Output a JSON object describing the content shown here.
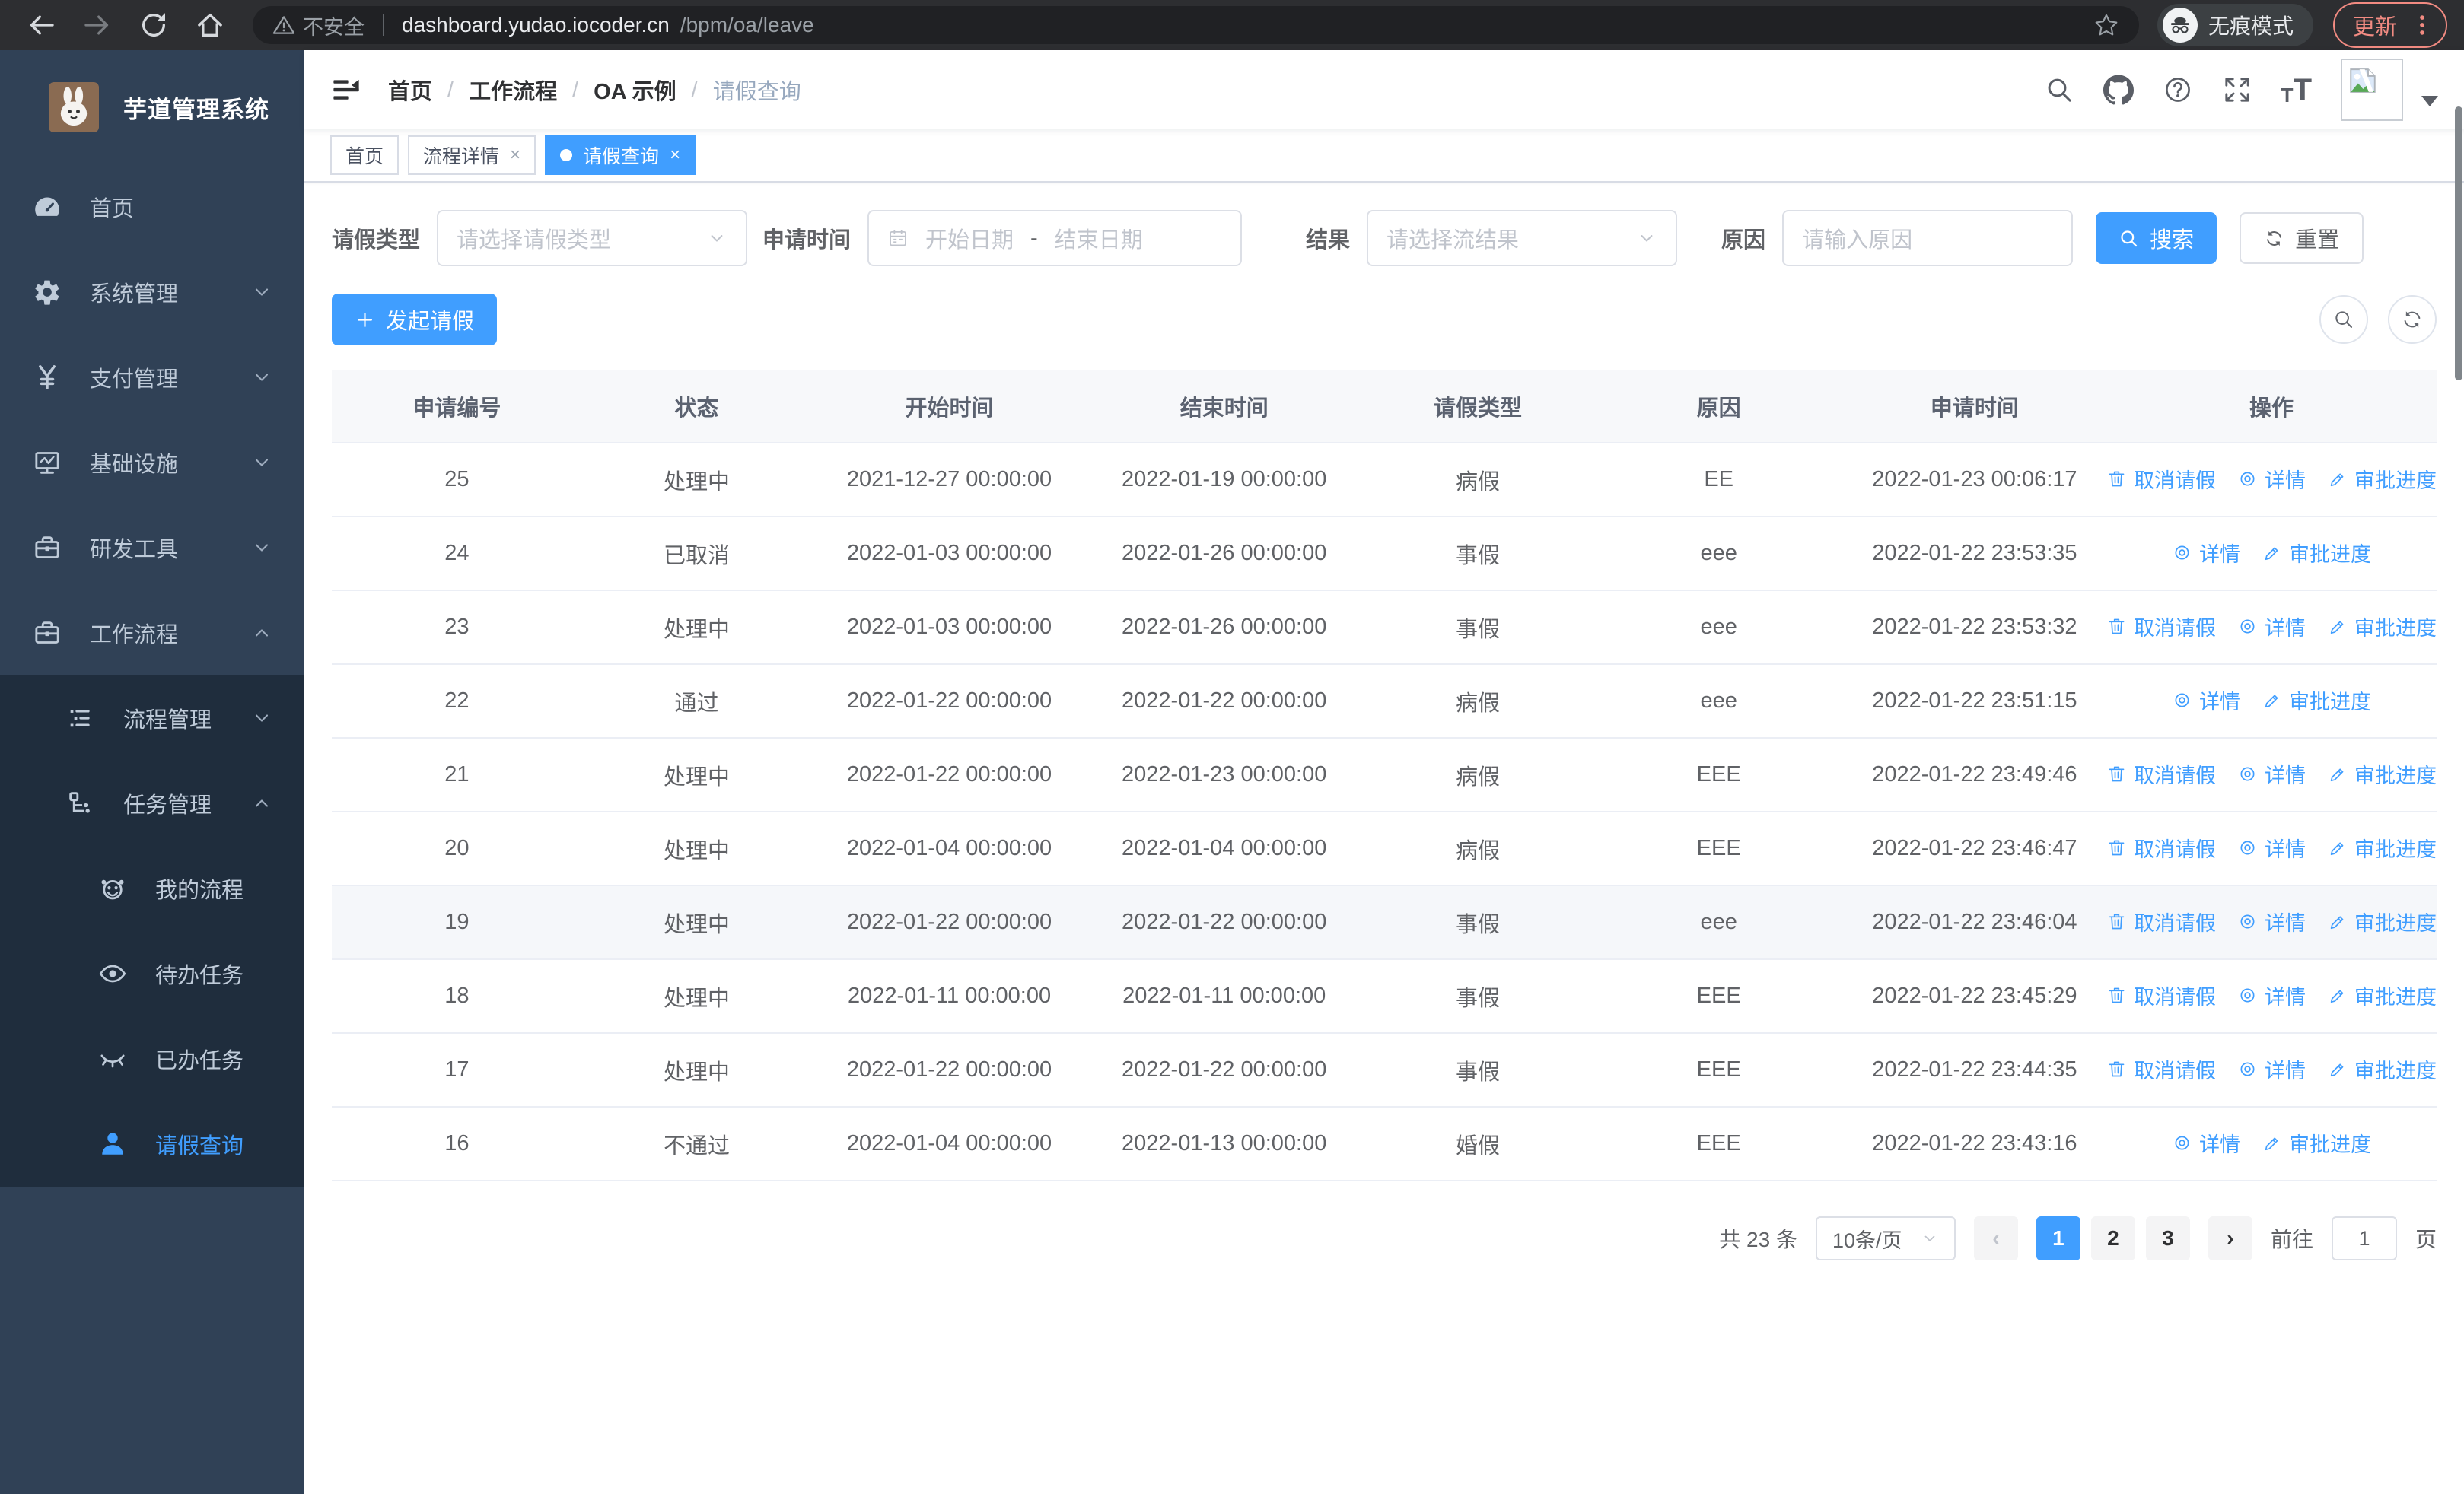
{
  "browser": {
    "security_label": "不安全",
    "url_host": "dashboard.yudao.iocoder.cn",
    "url_path": "/bpm/oa/leave",
    "incognito_label": "无痕模式",
    "update_label": "更新"
  },
  "colors": {
    "accent": "#409eff",
    "sidebar_bg": "#304156",
    "submenu_bg": "#1f2d3d",
    "update_accent": "#f28b82"
  },
  "sidebar": {
    "title": "芋道管理系统",
    "items": [
      {
        "name": "home",
        "label": "首页",
        "icon": "dashboard-icon",
        "level": 1
      },
      {
        "name": "system-management",
        "label": "系统管理",
        "icon": "gear-icon",
        "level": 1,
        "chevron": "down"
      },
      {
        "name": "payment-management",
        "label": "支付管理",
        "icon": "yen-icon",
        "level": 1,
        "chevron": "down"
      },
      {
        "name": "infrastructure",
        "label": "基础设施",
        "icon": "monitor-icon",
        "level": 1,
        "chevron": "down"
      },
      {
        "name": "dev-tools",
        "label": "研发工具",
        "icon": "toolbox-icon",
        "level": 1,
        "chevron": "down"
      },
      {
        "name": "workflow",
        "label": "工作流程",
        "icon": "briefcase-icon",
        "level": 1,
        "chevron": "up"
      },
      {
        "name": "process-management",
        "label": "流程管理",
        "icon": "list-icon",
        "level": 2,
        "chevron": "down",
        "in_submenu": true
      },
      {
        "name": "task-management",
        "label": "任务管理",
        "icon": "tree-icon",
        "level": 2,
        "chevron": "up",
        "in_submenu": true
      },
      {
        "name": "my-processes",
        "label": "我的流程",
        "icon": "robot-icon",
        "level": 3,
        "in_submenu": true
      },
      {
        "name": "todo-tasks",
        "label": "待办任务",
        "icon": "eye-icon",
        "level": 3,
        "in_submenu": true
      },
      {
        "name": "done-tasks",
        "label": "已办任务",
        "icon": "eye-closed-icon",
        "level": 3,
        "in_submenu": true
      },
      {
        "name": "leave-query",
        "label": "请假查询",
        "icon": "user-icon",
        "level": 3,
        "in_submenu": true,
        "active": true
      }
    ]
  },
  "navbar": {
    "breadcrumb": [
      "首页",
      "工作流程",
      "OA 示例",
      "请假查询"
    ]
  },
  "tabs": [
    {
      "name": "home",
      "label": "首页"
    },
    {
      "name": "process-detail",
      "label": "流程详情",
      "closable": true
    },
    {
      "name": "leave-query",
      "label": "请假查询",
      "closable": true,
      "active": true
    }
  ],
  "filters": {
    "leave_type": {
      "label": "请假类型",
      "placeholder": "请选择请假类型"
    },
    "apply_time": {
      "label": "申请时间",
      "start_placeholder": "开始日期",
      "separator": "-",
      "end_placeholder": "结束日期"
    },
    "result": {
      "label": "结果",
      "placeholder": "请选择流结果"
    },
    "reason": {
      "label": "原因",
      "placeholder": "请输入原因"
    },
    "search_label": "搜索",
    "reset_label": "重置"
  },
  "toolbar": {
    "create_label": "发起请假"
  },
  "table": {
    "columns": [
      "申请编号",
      "状态",
      "开始时间",
      "结束时间",
      "请假类型",
      "原因",
      "申请时间",
      "操作"
    ],
    "action_defs": {
      "cancel": {
        "label": "取消请假",
        "icon": "trash-icon"
      },
      "detail": {
        "label": "详情",
        "icon": "target-icon"
      },
      "progress": {
        "label": "审批进度",
        "icon": "edit-icon"
      }
    },
    "rows": [
      {
        "id": "25",
        "status": "处理中",
        "start": "2021-12-27 00:00:00",
        "end": "2022-01-19 00:00:00",
        "type": "病假",
        "reason": "EE",
        "apply": "2022-01-23 00:06:17",
        "actions": [
          "cancel",
          "detail",
          "progress"
        ]
      },
      {
        "id": "24",
        "status": "已取消",
        "start": "2022-01-03 00:00:00",
        "end": "2022-01-26 00:00:00",
        "type": "事假",
        "reason": "eee",
        "apply": "2022-01-22 23:53:35",
        "actions": [
          "detail",
          "progress"
        ]
      },
      {
        "id": "23",
        "status": "处理中",
        "start": "2022-01-03 00:00:00",
        "end": "2022-01-26 00:00:00",
        "type": "事假",
        "reason": "eee",
        "apply": "2022-01-22 23:53:32",
        "actions": [
          "cancel",
          "detail",
          "progress"
        ]
      },
      {
        "id": "22",
        "status": "通过",
        "start": "2022-01-22 00:00:00",
        "end": "2022-01-22 00:00:00",
        "type": "病假",
        "reason": "eee",
        "apply": "2022-01-22 23:51:15",
        "actions": [
          "detail",
          "progress"
        ]
      },
      {
        "id": "21",
        "status": "处理中",
        "start": "2022-01-22 00:00:00",
        "end": "2022-01-23 00:00:00",
        "type": "病假",
        "reason": "EEE",
        "apply": "2022-01-22 23:49:46",
        "actions": [
          "cancel",
          "detail",
          "progress"
        ]
      },
      {
        "id": "20",
        "status": "处理中",
        "start": "2022-01-04 00:00:00",
        "end": "2022-01-04 00:00:00",
        "type": "病假",
        "reason": "EEE",
        "apply": "2022-01-22 23:46:47",
        "actions": [
          "cancel",
          "detail",
          "progress"
        ]
      },
      {
        "id": "19",
        "status": "处理中",
        "start": "2022-01-22 00:00:00",
        "end": "2022-01-22 00:00:00",
        "type": "事假",
        "reason": "eee",
        "apply": "2022-01-22 23:46:04",
        "actions": [
          "cancel",
          "detail",
          "progress"
        ],
        "highlighted": true
      },
      {
        "id": "18",
        "status": "处理中",
        "start": "2022-01-11 00:00:00",
        "end": "2022-01-11 00:00:00",
        "type": "事假",
        "reason": "EEE",
        "apply": "2022-01-22 23:45:29",
        "actions": [
          "cancel",
          "detail",
          "progress"
        ]
      },
      {
        "id": "17",
        "status": "处理中",
        "start": "2022-01-22 00:00:00",
        "end": "2022-01-22 00:00:00",
        "type": "事假",
        "reason": "EEE",
        "apply": "2022-01-22 23:44:35",
        "actions": [
          "cancel",
          "detail",
          "progress"
        ]
      },
      {
        "id": "16",
        "status": "不通过",
        "start": "2022-01-04 00:00:00",
        "end": "2022-01-13 00:00:00",
        "type": "婚假",
        "reason": "EEE",
        "apply": "2022-01-22 23:43:16",
        "actions": [
          "detail",
          "progress"
        ]
      }
    ]
  },
  "pagination": {
    "total_label": "共 23 条",
    "page_size": "10条/页",
    "prev_glyph": "‹",
    "next_glyph": "›",
    "pages": [
      "1",
      "2",
      "3"
    ],
    "active_page": "1",
    "goto_label": "前往",
    "goto_value": "1",
    "page_suffix": "页"
  }
}
